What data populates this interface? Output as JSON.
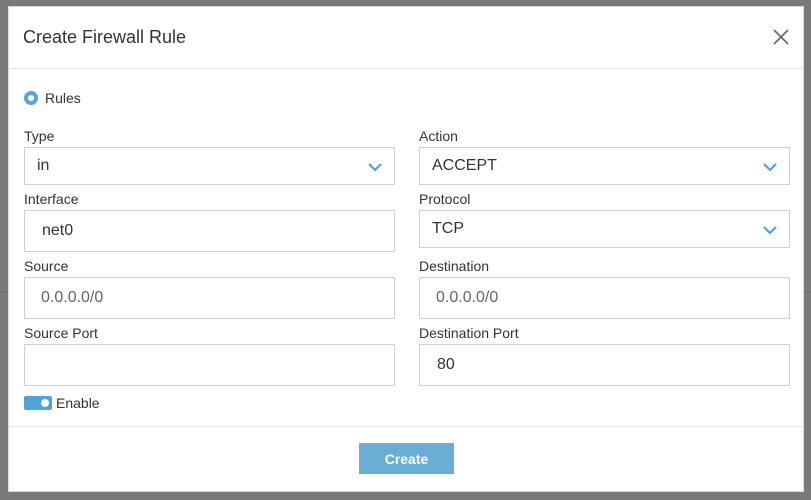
{
  "dialog": {
    "title": "Create Firewall Rule"
  },
  "rules_radio": {
    "label": "Rules",
    "selected": true
  },
  "fields": {
    "type": {
      "label": "Type",
      "value": "in"
    },
    "action": {
      "label": "Action",
      "value": "ACCEPT"
    },
    "interface": {
      "label": "Interface",
      "value": "net0"
    },
    "protocol": {
      "label": "Protocol",
      "value": "TCP"
    },
    "source": {
      "label": "Source",
      "placeholder": "0.0.0.0/0",
      "value": ""
    },
    "destination": {
      "label": "Destination",
      "placeholder": "0.0.0.0/0",
      "value": ""
    },
    "source_port": {
      "label": "Source Port",
      "value": ""
    },
    "destination_port": {
      "label": "Destination Port",
      "value": "80"
    }
  },
  "enable_toggle": {
    "label": "Enable",
    "on": true
  },
  "footer": {
    "create_label": "Create"
  },
  "icons": {
    "close": "close-icon",
    "chevron": "chevron-down-icon"
  },
  "colors": {
    "accent": "#5aa6d6",
    "button": "#6aaed6",
    "chevron": "#4fa3d7"
  }
}
